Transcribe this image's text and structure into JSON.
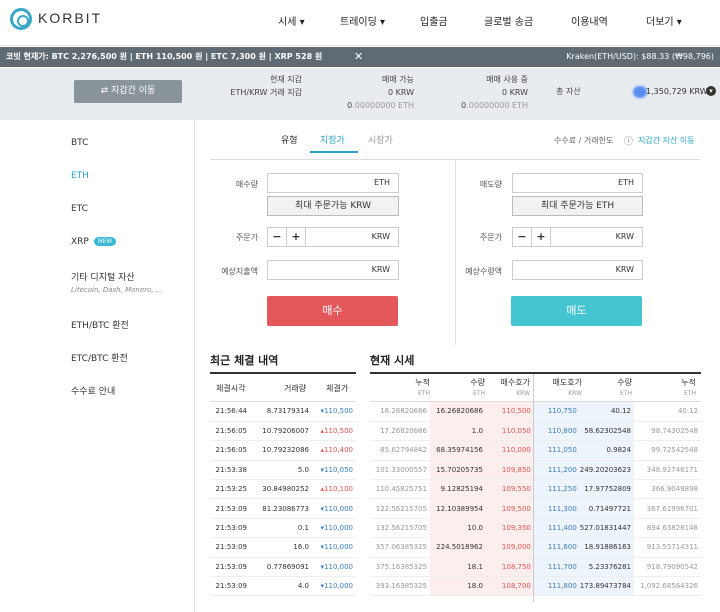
{
  "header": {
    "brand": "KORBIT",
    "nav": [
      "시세 ▾",
      "트레이딩 ▾",
      "입출금",
      "글로벌 송금",
      "이용내역",
      "더보기 ▾"
    ]
  },
  "ticker": {
    "text": "코빗 현재가: BTC 2,276,500 원 | ETH 110,500 원 | ETC 7,300 원 | XRP 528 원",
    "kraken": "Kraken(ETH/USD): $88.33 (₩98,796)"
  },
  "wallet": {
    "button": "⇄ 지갑간 이동",
    "current_label": "현재 지갑",
    "current_value": "ETH/KRW 거래 지갑",
    "avail_label": "매매 가능",
    "avail_krw": "0 KRW",
    "avail_eth_a": "0",
    "avail_eth_b": ".00000000 ETH",
    "inuse_label": "매매 사용 중",
    "inuse_krw": "0 KRW",
    "inuse_eth_a": "0",
    "inuse_eth_b": ".00000000 ETH",
    "total_label": "총 자산",
    "total_value": "1,350,729 KRW"
  },
  "sidebar": {
    "items": [
      "BTC",
      "ETH",
      "ETC",
      "XRP",
      "기타 디지털 자산",
      "ETH/BTC 환전",
      "ETC/BTC 환전",
      "수수료 안내"
    ],
    "xrp_badge": "NEW",
    "other_sub": "Litecoin, Dash, Monero, ..."
  },
  "tabs": {
    "t1": "유형",
    "t2": "지정가",
    "t3": "시장가",
    "fee": "수수료 / 거래한도",
    "fee_icon": "ⓘ",
    "transfer": "지갑간 자산 이동"
  },
  "buy": {
    "qty_label": "매수량",
    "qty_unit": "ETH",
    "max_btn": "최대 주문가능 KRW",
    "price_label": "주문가",
    "price_unit": "KRW",
    "exp_label": "예상지출액",
    "exp_unit": "KRW",
    "submit": "매수",
    "minus": "−",
    "plus": "+"
  },
  "sell": {
    "qty_label": "매도량",
    "qty_unit": "ETH",
    "max_btn": "최대 주문가능 ETH",
    "price_label": "주문가",
    "price_unit": "KRW",
    "exp_label": "예상수령액",
    "exp_unit": "KRW",
    "submit": "매도",
    "minus": "−",
    "plus": "+"
  },
  "trades": {
    "title": "최근 체결 내역",
    "headers": [
      "체결시각",
      "거래량",
      "체결가"
    ],
    "rows": [
      [
        "21:56:44",
        "8.73179314",
        "110,500",
        "dn"
      ],
      [
        "21:56:05",
        "10.79206007",
        "110,500",
        "up"
      ],
      [
        "21:56:05",
        "10.79232086",
        "110,400",
        "up"
      ],
      [
        "21:53:38",
        "5.0",
        "110,050",
        "dn"
      ],
      [
        "21:53:25",
        "30.84980252",
        "110,100",
        "up"
      ],
      [
        "21:53:09",
        "81.23086773",
        "110,000",
        "dn"
      ],
      [
        "21:53:09",
        "0.1",
        "110,000",
        "dn"
      ],
      [
        "21:53:09",
        "16.0",
        "110,000",
        "dn"
      ],
      [
        "21:53:09",
        "0.77869091",
        "110,000",
        "dn"
      ],
      [
        "21:53:09",
        "4.0",
        "110,000",
        "dn"
      ]
    ]
  },
  "orderbook": {
    "title": "현재 시세",
    "headers": [
      "누적",
      "수량",
      "매수호가",
      "매도호가",
      "수량",
      "누적"
    ],
    "subs": [
      "ETH",
      "ETH",
      "KRW",
      "KRW",
      "ETH",
      "ETH"
    ],
    "rows": [
      [
        "16.26820686",
        "16.26820686",
        "110,500",
        "110,750",
        "40.12",
        "40.12"
      ],
      [
        "17.26820686",
        "1.0",
        "110,050",
        "110,800",
        "58.62302548",
        "98.74302548"
      ],
      [
        "85.62794842",
        "68.35974156",
        "110,000",
        "111,050",
        "0.9824",
        "99.72542548"
      ],
      [
        "101.33000557",
        "15.70205735",
        "109,850",
        "111,200",
        "249.20203623",
        "348.92746171"
      ],
      [
        "110.45825751",
        "9.12825194",
        "109,550",
        "111,250",
        "17.97752809",
        "366.9049898"
      ],
      [
        "122.56215705",
        "12.10389954",
        "109,500",
        "111,300",
        "0.71497721",
        "367.61996701"
      ],
      [
        "132.56215705",
        "10.0",
        "109,350",
        "111,400",
        "527.01831447",
        "894.63828148"
      ],
      [
        "357.06385325",
        "224.5018962",
        "109,000",
        "111,600",
        "18.91886163",
        "913.55714311"
      ],
      [
        "375.16385325",
        "18.1",
        "108,750",
        "111,700",
        "5.23376281",
        "918.79090542"
      ],
      [
        "393.16385325",
        "18.0",
        "108,700",
        "111,800",
        "173.89473784",
        "1,092.68564326"
      ]
    ]
  }
}
